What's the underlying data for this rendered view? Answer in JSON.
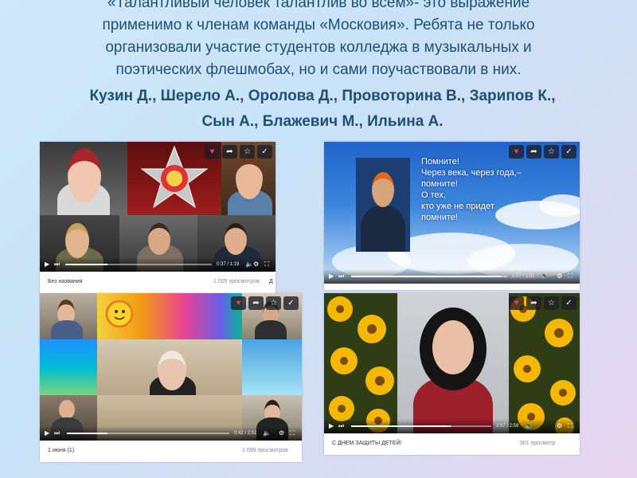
{
  "slide": {
    "text_lines": [
      "«Талантливый человек талантлив во всем»- это выражение",
      "применимо к  членам  команды «Московия». Ребята не только",
      "организовали участие студентов колледжа в музыкальных и",
      "поэтических флешмобах, но и сами   поучаствовали в них."
    ],
    "authors_line1": "Кузин Д., Шерело А., Оролова Д., Провоторина В.,  Зарипов К.,",
    "authors_line2": "Сын А., Блажевич М., Ильина А."
  },
  "videos": [
    {
      "title": "Без названия",
      "views": "1 005 просмотров",
      "time": "0:37 / 1:19",
      "progress": 0.29,
      "extra": "Д"
    },
    {
      "title": "",
      "views": "",
      "time": "1:57 / 2:01",
      "progress": 0.96,
      "quote_lines": [
        "Помните!",
        "Через века, через года,–",
        "помните!",
        "О тех,",
        "кто уже не придет",
        "помните!"
      ]
    },
    {
      "title": "1 июня (1)",
      "views": "1 099 просмотров",
      "time": "0:42 / 2:51",
      "progress": 0.25
    },
    {
      "title": "С ДНЕМ ЗАЩИТЫ ДЕТЕЙ!",
      "views": "901 просмотр",
      "time": "2:07 / 2:59",
      "progress": 0.71
    }
  ],
  "icons": {
    "like": "heart-icon",
    "share": "share-icon",
    "save": "star-icon",
    "watched": "check-icon",
    "play": "play-icon",
    "next": "next-icon",
    "volume": "volume-icon",
    "settings": "gear-icon",
    "fullscreen": "fullscreen-icon"
  },
  "colors": {
    "title_text": "#1f4f73",
    "like": "#ff3b4e",
    "player_bar": "#1e1e28"
  }
}
